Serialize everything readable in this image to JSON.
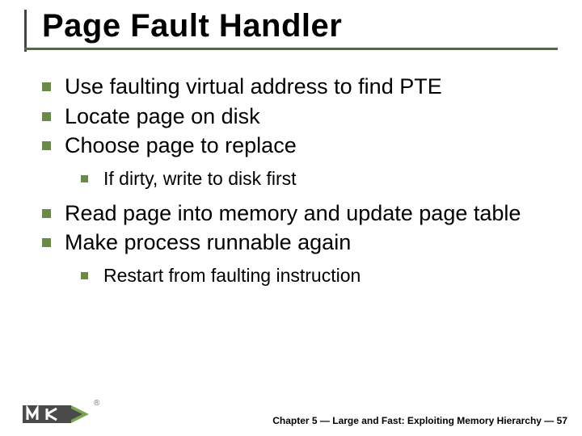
{
  "title": "Page Fault Handler",
  "bullets": [
    {
      "text": "Use faulting virtual address to find PTE"
    },
    {
      "text": "Locate page on disk"
    },
    {
      "text": "Choose page to replace",
      "sub": [
        {
          "text": "If dirty, write to disk first"
        }
      ]
    },
    {
      "text": "Read page into memory and update page table"
    },
    {
      "text": "Make process runnable again",
      "sub": [
        {
          "text": "Restart from faulting instruction"
        }
      ]
    }
  ],
  "footer": {
    "chapter": "Chapter 5 — Large and Fast: Exploiting Memory Hierarchy — 57"
  },
  "logo": {
    "registered": "®"
  }
}
